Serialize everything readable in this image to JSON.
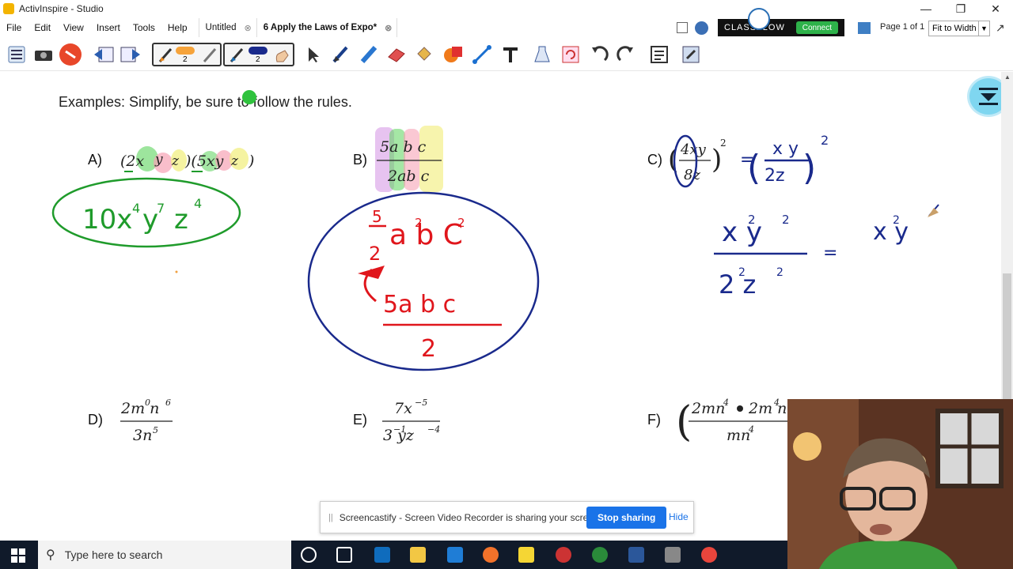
{
  "window": {
    "title": "ActivInspire - Studio"
  },
  "menu": [
    "File",
    "Edit",
    "View",
    "Insert",
    "Tools",
    "Help"
  ],
  "tabs": [
    {
      "label": "Untitled"
    },
    {
      "label": "6 Apply the Laws of Expo*"
    }
  ],
  "classflow": {
    "text": "CLASSFLOW",
    "connect": "Connect"
  },
  "page_nav": {
    "page": "Page 1 of 1",
    "zoom": "Fit to Width"
  },
  "toolbar": {
    "pen1_width": "2",
    "pen2_width": "2"
  },
  "colors": {
    "pen_green": "#1f9b2b",
    "pen_blue": "#1a2a8c",
    "pen_red": "#e0161c",
    "share_button": "#1a73e8"
  },
  "slide": {
    "heading": "Examples: Simplify, be sure to follow the rules.",
    "problems": {
      "a": {
        "label": "A)"
      },
      "b": {
        "label": "B)"
      },
      "c": {
        "label": "C)"
      },
      "d": {
        "label": "D)"
      },
      "e": {
        "label": "E)"
      },
      "f": {
        "label": "F)"
      }
    }
  },
  "share_bar": {
    "message": "Screencastify - Screen Video Recorder is sharing your screen.",
    "stop": "Stop sharing",
    "hide": "Hide"
  },
  "taskbar": {
    "search_placeholder": "Type here to search"
  }
}
